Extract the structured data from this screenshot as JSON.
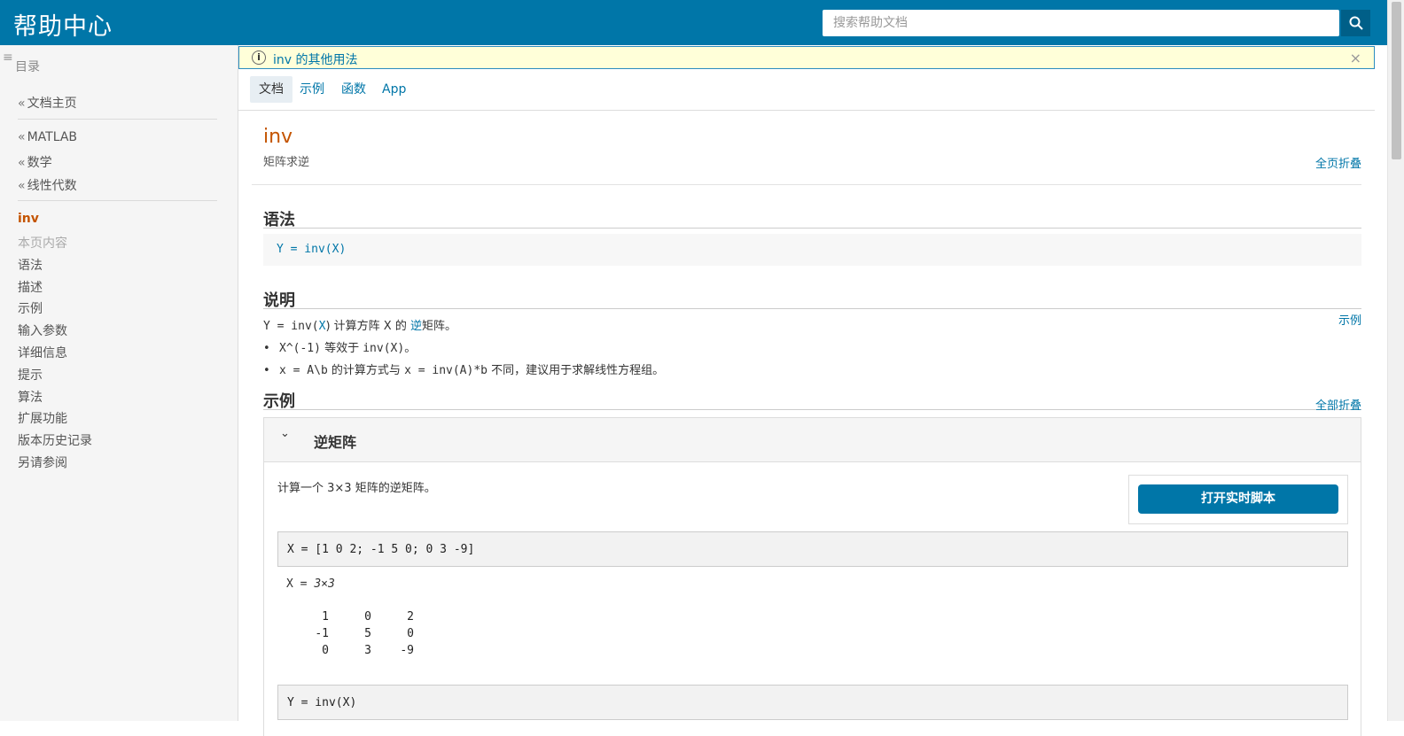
{
  "header": {
    "brand": "帮助中心",
    "search_placeholder": "搜索帮助文档"
  },
  "sidebar": {
    "toc_title": "目录",
    "home": "文档主页",
    "crumbs": [
      "MATLAB",
      "数学",
      "线性代数"
    ],
    "current": "inv",
    "on_page_label": "本页内容",
    "sections": [
      "语法",
      "描述",
      "示例",
      "输入参数",
      "详细信息",
      "提示",
      "算法",
      "扩展功能",
      "版本历史记录",
      "另请参阅"
    ]
  },
  "infobar": {
    "text": "inv 的其他用法",
    "close": "×"
  },
  "tabs": [
    "文档",
    "示例",
    "函数",
    "App"
  ],
  "page": {
    "title": "inv",
    "purpose": "矩阵求逆",
    "collapse_page": "全页折叠"
  },
  "syntax": {
    "heading": "语法",
    "code": "Y = inv(X)"
  },
  "description": {
    "heading": "说明",
    "side_link": "示例",
    "line1_pre": "Y = inv(",
    "line1_x": "X",
    "line1_mid": ") 计算方阵 X 的 ",
    "line1_link": "逆",
    "line1_post": "矩阵。",
    "bullet1_code": "X^(-1)",
    "bullet1_mid": " 等效于 ",
    "bullet1_code2": "inv(X)",
    "bullet1_end": "。",
    "bullet2_code": "x = A\\b",
    "bullet2_mid": " 的计算方式与 ",
    "bullet2_code2": "x = inv(A)*b",
    "bullet2_end": " 不同，建议用于求解线性方程组。"
  },
  "examples": {
    "heading": "示例",
    "collapse_all": "全部折叠",
    "panel_title": "逆矩阵",
    "desc": "计算一个 3×3 矩阵的逆矩阵。",
    "live_script_button": "打开实时脚本",
    "code1": "X = [1 0 2; -1 5 0; 0 3 -9]",
    "out_label": "X = ",
    "out_size": "3×3",
    "matrix": [
      [
        "1",
        "0",
        "2"
      ],
      [
        "-1",
        "5",
        "0"
      ],
      [
        "0",
        "3",
        "-9"
      ]
    ],
    "code2": "Y = inv(X)"
  },
  "colors": {
    "header": "#0076a8",
    "accent_orange": "#c45400",
    "link_blue": "#0076a8",
    "infobar_bg": "#ffffd9"
  }
}
